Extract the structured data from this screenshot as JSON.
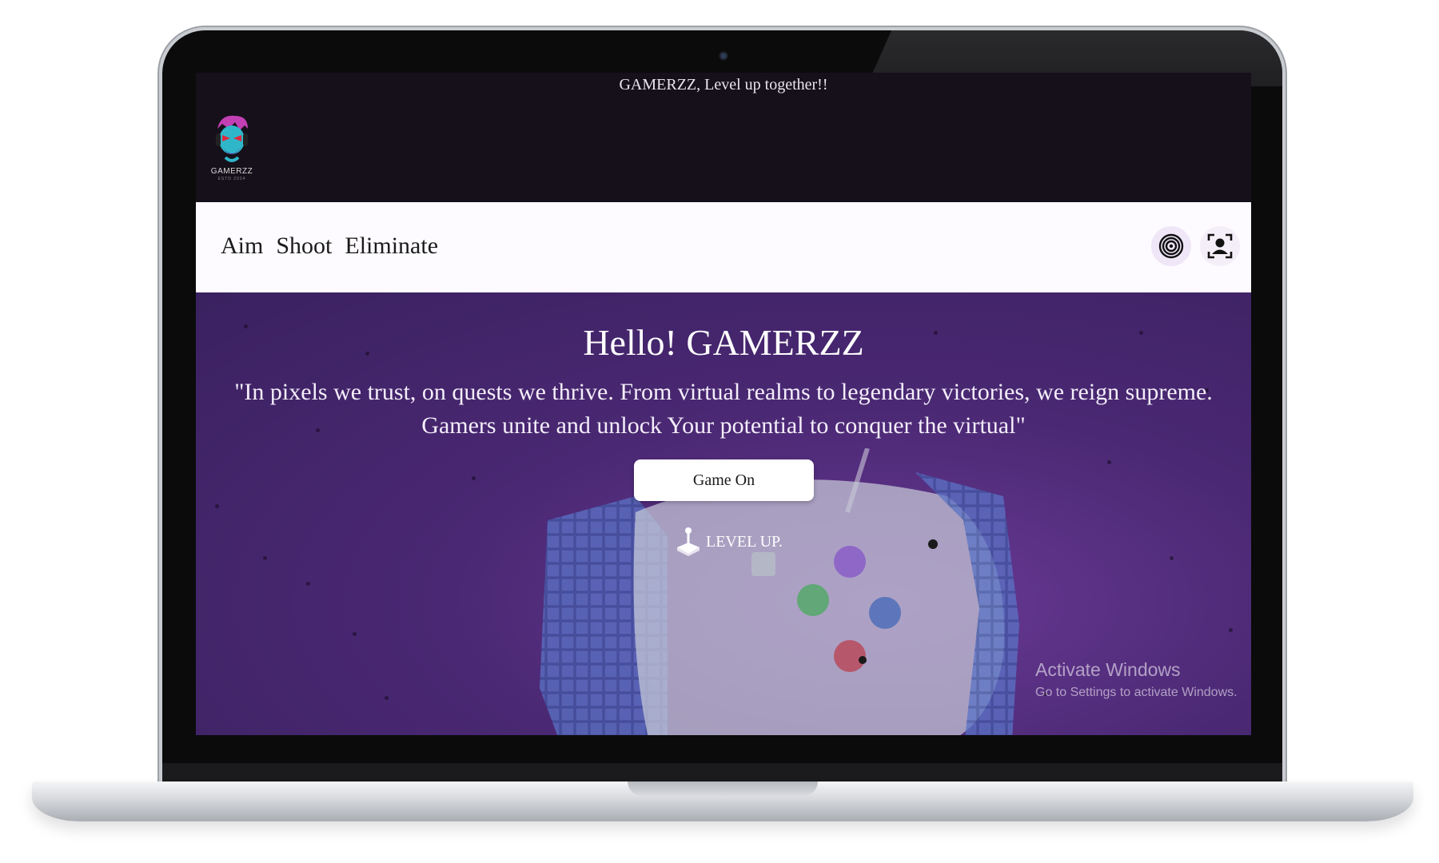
{
  "site": {
    "tagline": "GAMERZZ, Level up together!!",
    "logo_text": "GAMERZZ",
    "logo_subtext": "ESTD 2024"
  },
  "nav": {
    "links": [
      "Aim",
      "Shoot",
      "Eliminate"
    ],
    "icons": [
      "fingerprint-icon",
      "profile-scan-icon"
    ]
  },
  "hero": {
    "title": "Hello! GAMERZZ",
    "quote": "\"In pixels we trust, on quests we thrive. From virtual realms to legendary victories, we reign supreme. Gamers unite and unlock Your potential to conquer the virtual\"",
    "cta_label": "Game On",
    "level_up_label": "LEVEL UP.",
    "level_up_icon": "joystick-icon"
  },
  "watermark": {
    "title": "Activate Windows",
    "subtitle": "Go to Settings to activate Windows."
  },
  "colors": {
    "banner_bg": "#16101a",
    "navbar_bg": "#fdfbff",
    "hero_bg": "#4a2873",
    "icon_bubble": "#efe6f8"
  }
}
